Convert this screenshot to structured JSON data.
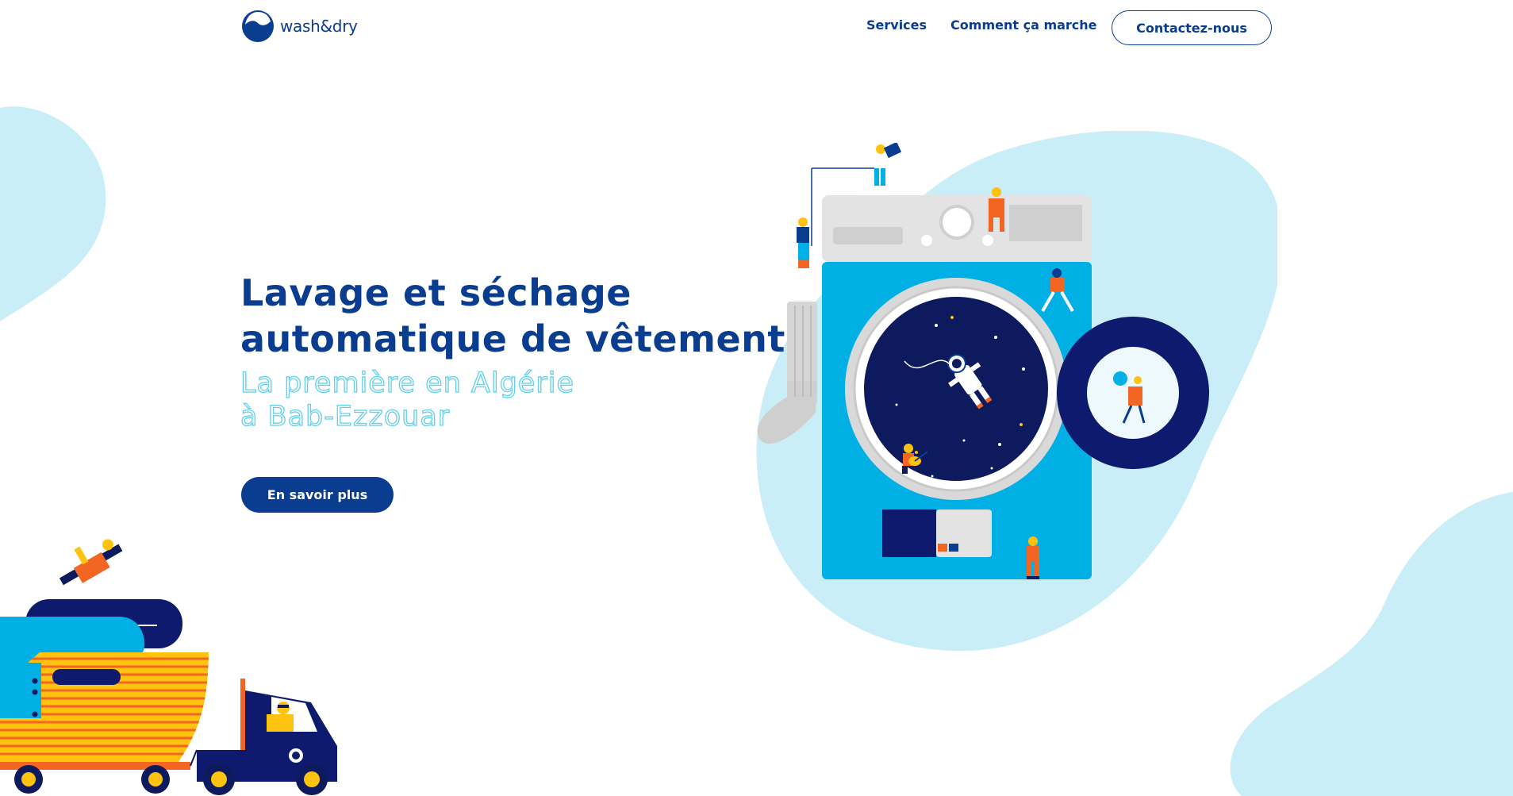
{
  "brand": {
    "name": "wash&dry"
  },
  "nav": {
    "items": [
      {
        "label": "Services"
      },
      {
        "label": "Comment ça marche"
      }
    ],
    "contact_label": "Contactez-nous"
  },
  "hero": {
    "title_lines": [
      "Lavage et séchage",
      "automatique de vêtements"
    ],
    "subtitle_lines": [
      "La première en Algérie",
      "à Bab-Ezzouar"
    ],
    "cta_label": "En savoir plus"
  },
  "colors": {
    "primary": "#0a3d8f",
    "accent_cyan": "#5fd0ec",
    "blob_light": "#c9eef8",
    "machine_blue": "#00b0e4",
    "orange": "#f26522",
    "yellow": "#ffc20e"
  },
  "icons": {
    "logo": "drop-in-circle-icon"
  }
}
